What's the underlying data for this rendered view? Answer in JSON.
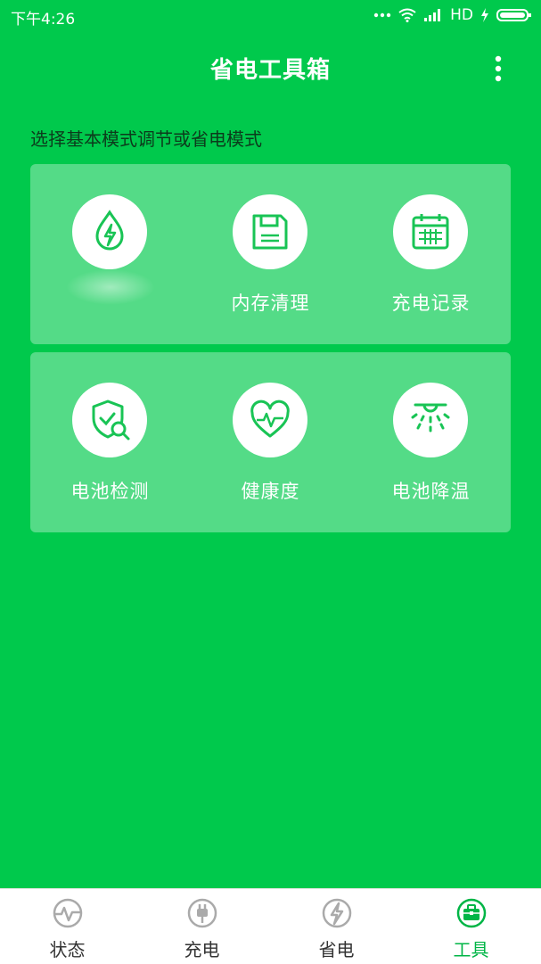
{
  "status_bar": {
    "time": "下午4:26",
    "network": "HD"
  },
  "header": {
    "title": "省电工具箱"
  },
  "subtitle": "选择基本模式调节或省电模式",
  "tools_row1": [
    {
      "label": "",
      "icon": "leaf-bolt-icon"
    },
    {
      "label": "内存清理",
      "icon": "floppy-disk-icon"
    },
    {
      "label": "充电记录",
      "icon": "calendar-icon"
    }
  ],
  "tools_row2": [
    {
      "label": "电池检测",
      "icon": "shield-search-icon"
    },
    {
      "label": "健康度",
      "icon": "heart-pulse-icon"
    },
    {
      "label": "电池降温",
      "icon": "sprinkler-icon"
    }
  ],
  "bottom_nav": [
    {
      "label": "状态",
      "icon": "pulse-icon",
      "active": false
    },
    {
      "label": "充电",
      "icon": "plug-icon",
      "active": false
    },
    {
      "label": "省电",
      "icon": "bolt-icon",
      "active": false
    },
    {
      "label": "工具",
      "icon": "toolbox-icon",
      "active": true
    }
  ],
  "colors": {
    "background": "#00c94c",
    "accent": "#00b546",
    "icon_green": "#19c455"
  }
}
